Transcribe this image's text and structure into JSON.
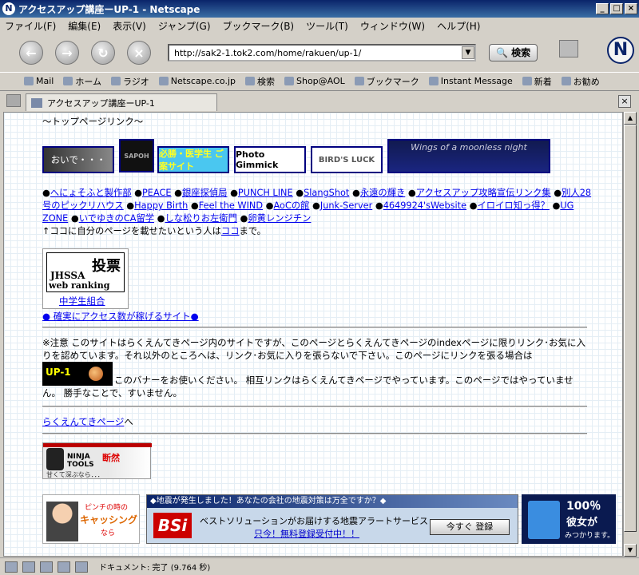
{
  "window": {
    "title": "アクセスアップ講座ーUP-1 - Netscape",
    "icon": "N"
  },
  "menu": [
    "ファイル(F)",
    "編集(E)",
    "表示(V)",
    "ジャンプ(G)",
    "ブックマーク(B)",
    "ツール(T)",
    "ウィンドウ(W)",
    "ヘルプ(H)"
  ],
  "nav": {
    "url": "http://sak2-1.tok2.com/home/rakuen/up-1/",
    "search": "検索"
  },
  "bookmarks": [
    "Mail",
    "ホーム",
    "ラジオ",
    "Netscape.co.jp",
    "検索",
    "Shop@AOL",
    "ブックマーク",
    "Instant Message",
    "新着",
    "お勧め"
  ],
  "tab": {
    "label": "アクセスアップ講座ーUP-1"
  },
  "page": {
    "heading": "〜トップページリンク〜",
    "banners": [
      "おいで・・・",
      "SAPOH",
      "必勝・医学生 ご案サイト",
      "Photo Gimmick",
      "BIRD'S LUCK",
      "Wings of a moonless night"
    ],
    "links": [
      "へにょそふと製作部",
      "PEACE",
      "銀座探偵局",
      "PUNCH LINE",
      "SlangShot",
      "永遠の輝き",
      "アクセスアップ攻略宣伝リンク集",
      "別人28号のピックリハウス",
      "Happy Birth",
      "Feel the WIND",
      "AoCの館",
      "Junk-Server",
      "4649924'sWebsite",
      "イロイロ知っ得？",
      "UG ZONE",
      "いでゆきのCA留学",
      "しな松りお左衛門",
      "卵黄レンジチン"
    ],
    "note_prefix": "↑ココに自分のページを載せたいという人は",
    "note_link": "ココ",
    "note_suffix": "まで。",
    "vote_title": "投票",
    "vote_line1": "JHSSA",
    "vote_line2": "web ranking",
    "vote_link": "中学生組合",
    "access_link": "● 確実にアクセス数が稼げるサイト●",
    "notice1": "※注意 このサイトはらくえんてきページ内のサイトですが、このページとらくえんてきページのindexページに限りリンク･お気に入りを認めています。それ以外のところへは、リンク･お気に入りを張らないで下さい。このページにリンクを張る場合は",
    "up1_banner": "UP-1",
    "notice2": "このバナーをお使いください。 相互リンクはらくえんてきページでやっています。このページではやっていません。 勝手なことで、すいません。",
    "back_link": "らくえんてきページ",
    "back_suffix": "へ",
    "ninja_text": "NINJA TOOLS",
    "ninja_sub": "断然",
    "ninja_foot": "甘くて深ぶなら．．．",
    "ad_left_1": "ピンチの時の",
    "ad_left_2": "キャッシング",
    "ad_left_3": "なら",
    "ad_top": "◆地震が発生しました！あなたの会社の地震対策は万全ですか？◆",
    "ad_logo": "BSi",
    "ad_main": "ベストソリューションがお届けする地震アラートサービス",
    "ad_link": "只今！無料登録受付中！！",
    "ad_button": "今すぐ 登録",
    "ad_right_1": "100％",
    "ad_right_2": "彼女が",
    "ad_right_3": "みつかります。"
  },
  "status": {
    "text": "ドキュメント: 完了 (9.764 秒)"
  }
}
